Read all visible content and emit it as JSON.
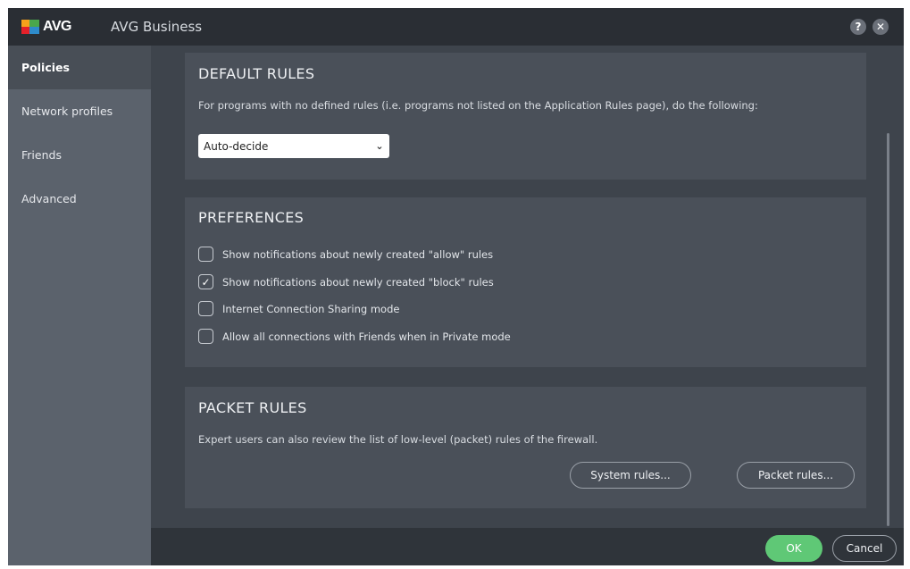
{
  "titlebar": {
    "logo_text": "AVG",
    "app_title": "AVG Business",
    "help_label": "?",
    "close_label": "✕"
  },
  "sidebar": {
    "items": [
      {
        "label": "Policies",
        "active": true
      },
      {
        "label": "Network profiles",
        "active": false
      },
      {
        "label": "Friends",
        "active": false
      },
      {
        "label": "Advanced",
        "active": false
      }
    ]
  },
  "default_rules": {
    "title": "DEFAULT RULES",
    "description": "For programs with no defined rules (i.e. programs not listed on the Application Rules page), do the following:",
    "selected_option": "Auto-decide"
  },
  "preferences": {
    "title": "PREFERENCES",
    "options": [
      {
        "label": "Show notifications about newly created \"allow\" rules",
        "checked": false
      },
      {
        "label": "Show notifications about newly created \"block\" rules",
        "checked": true
      },
      {
        "label": "Internet Connection Sharing mode",
        "checked": false
      },
      {
        "label": "Allow all connections with Friends when in Private mode",
        "checked": false
      }
    ],
    "check_glyph": "✓"
  },
  "packet_rules": {
    "title": "PACKET RULES",
    "description": "Expert users can also review the list of low-level (packet) rules of the firewall.",
    "system_rules_label": "System rules...",
    "packet_rules_label": "Packet rules..."
  },
  "footer": {
    "ok_label": "OK",
    "cancel_label": "Cancel"
  },
  "colors": {
    "accent_green": "#5fc876",
    "titlebar_bg": "#2a2e34",
    "sidebar_bg": "#5b626c",
    "panel_bg": "#4a5059"
  }
}
